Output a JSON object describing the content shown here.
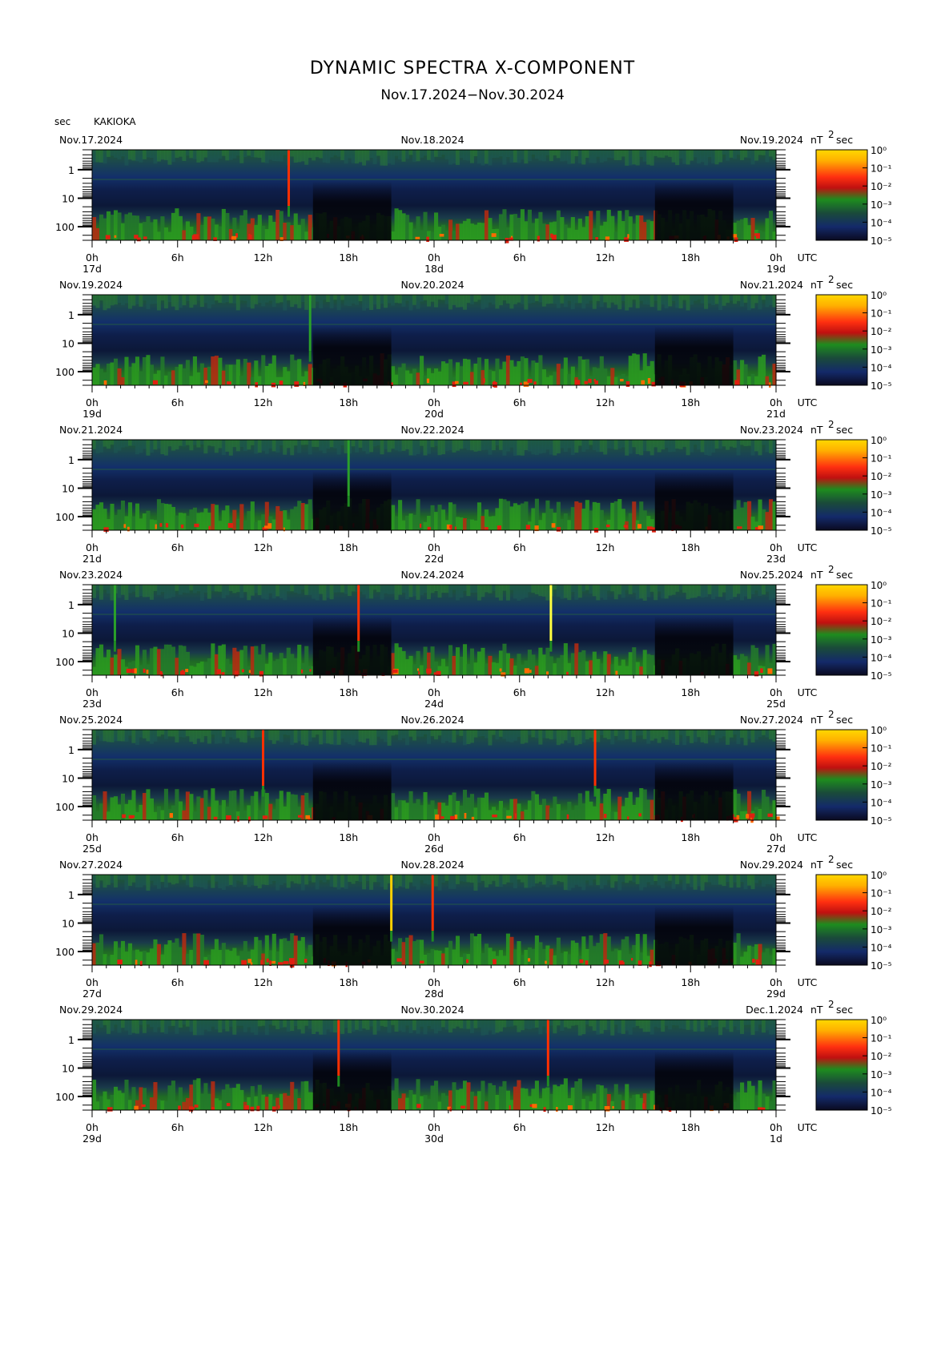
{
  "title": "DYNAMIC SPECTRA X-COMPONENT",
  "subtitle": "Nov.17.2024−Nov.30.2024",
  "y_unit_label": "sec",
  "station": "KAKIOKA",
  "colorbar_unit": "nT",
  "colorbar_unit_exp": "2",
  "colorbar_unit_sec": "sec",
  "utc_label": "UTC",
  "chart_data": {
    "type": "heatmap",
    "y_axis": {
      "scale": "log",
      "reversed": true,
      "ticks": [
        "1",
        "10",
        "100"
      ],
      "range_sec": [
        0.2,
        300
      ]
    },
    "x_axis": {
      "ticks": [
        "0h",
        "6h",
        "12h",
        "18h",
        "0h",
        "6h",
        "12h",
        "18h",
        "0h"
      ],
      "span_hours": 48
    },
    "colorbar": {
      "scale": "log",
      "colors": [
        "#0a0a2a",
        "#1a3a8a",
        "#2a8a2a",
        "#1fa01f",
        "#d01010",
        "#ff5000",
        "#ffd000",
        "#ffff40"
      ],
      "ticks": [
        "10⁰",
        "10⁻¹",
        "10⁻²",
        "10⁻³",
        "10⁻⁴",
        "10⁻⁵"
      ]
    },
    "panels": [
      {
        "left_date": "Nov.17.2024",
        "mid_date": "Nov.18.2024",
        "right_date": "Nov.19.2024",
        "day_labels": [
          "17d",
          "18d",
          "19d"
        ],
        "spikes_hours": [
          13.8
        ],
        "spike_colors": [
          "#ff3000"
        ]
      },
      {
        "left_date": "Nov.19.2024",
        "mid_date": "Nov.20.2024",
        "right_date": "Nov.21.2024",
        "day_labels": [
          "19d",
          "20d",
          "21d"
        ],
        "spikes_hours": [
          15.3
        ],
        "spike_colors": [
          "#2aa02a"
        ]
      },
      {
        "left_date": "Nov.21.2024",
        "mid_date": "Nov.22.2024",
        "right_date": "Nov.23.2024",
        "day_labels": [
          "21d",
          "22d",
          "23d"
        ],
        "spikes_hours": [
          18.0
        ],
        "spike_colors": [
          "#2aa02a"
        ]
      },
      {
        "left_date": "Nov.23.2024",
        "mid_date": "Nov.24.2024",
        "right_date": "Nov.25.2024",
        "day_labels": [
          "23d",
          "24d",
          "25d"
        ],
        "spikes_hours": [
          18.7,
          32.2,
          1.6
        ],
        "spike_colors": [
          "#ff3000",
          "#ffff40",
          "#2aa02a"
        ]
      },
      {
        "left_date": "Nov.25.2024",
        "mid_date": "Nov.26.2024",
        "right_date": "Nov.27.2024",
        "day_labels": [
          "25d",
          "26d",
          "27d"
        ],
        "spikes_hours": [
          12.0,
          35.3
        ],
        "spike_colors": [
          "#ff3000",
          "#ff3000"
        ]
      },
      {
        "left_date": "Nov.27.2024",
        "mid_date": "Nov.28.2024",
        "right_date": "Nov.29.2024",
        "day_labels": [
          "27d",
          "28d",
          "29d"
        ],
        "spikes_hours": [
          21.0,
          23.9
        ],
        "spike_colors": [
          "#ffd000",
          "#ff3000"
        ]
      },
      {
        "left_date": "Nov.29.2024",
        "mid_date": "Nov.30.2024",
        "right_date": "Dec.1.2024",
        "day_labels": [
          "29d",
          "30d",
          "1d"
        ],
        "spikes_hours": [
          17.3,
          32.0
        ],
        "spike_colors": [
          "#ff3000",
          "#ff3000"
        ]
      }
    ]
  }
}
